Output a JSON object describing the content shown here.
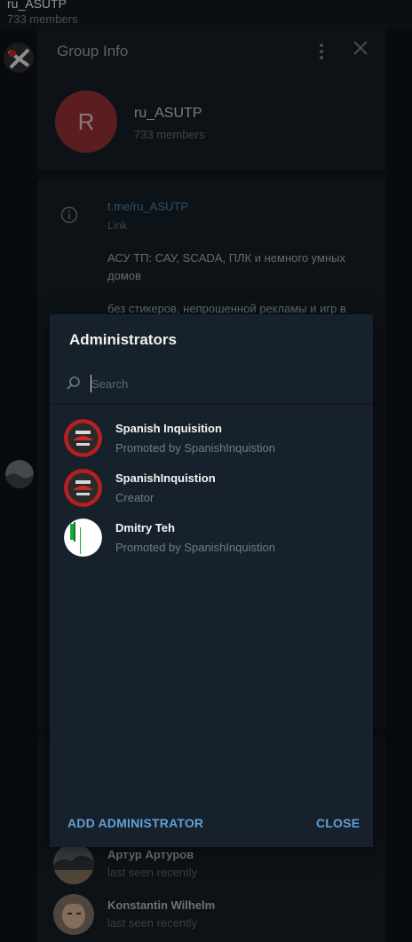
{
  "background_chat": {
    "title": "ru_ASUTP",
    "subtitle": "733 members"
  },
  "group_info": {
    "title": "Group Info",
    "avatar_letter": "R",
    "avatar_color": "#8c2d30",
    "name": "ru_ASUTP",
    "members": "733 members",
    "link": "t.me/ru_ASUTP",
    "link_label": "Link",
    "description_line1": "АСУ ТП: САУ, SCADA, ПЛК и немного умных домов",
    "description_line2": "без стикеров, непрошенной рекламы и игр в",
    "visible_members": [
      {
        "name": "Артур Артуров",
        "status": "last seen recently"
      },
      {
        "name": "Konstantin Wilhelm",
        "status": "last seen recently"
      }
    ]
  },
  "admin_dialog": {
    "title": "Administrators",
    "search_placeholder": "Search",
    "admins": [
      {
        "name": "Spanish Inquisition",
        "status": "Promoted by SpanishInquistion",
        "avatar": "red-badge-avatar"
      },
      {
        "name": "SpanishInquistion",
        "status": "Creator",
        "avatar": "red-badge-avatar"
      },
      {
        "name": "Dmitry Teh",
        "status": "Promoted by SpanishInquistion",
        "avatar": "white-green-avatar"
      }
    ],
    "add_button": "ADD ADMINISTRATOR",
    "close_button": "CLOSE"
  },
  "colors": {
    "accent": "#5fa0d8",
    "dialog_bg": "#17212b",
    "page_bg": "#0b1016"
  }
}
